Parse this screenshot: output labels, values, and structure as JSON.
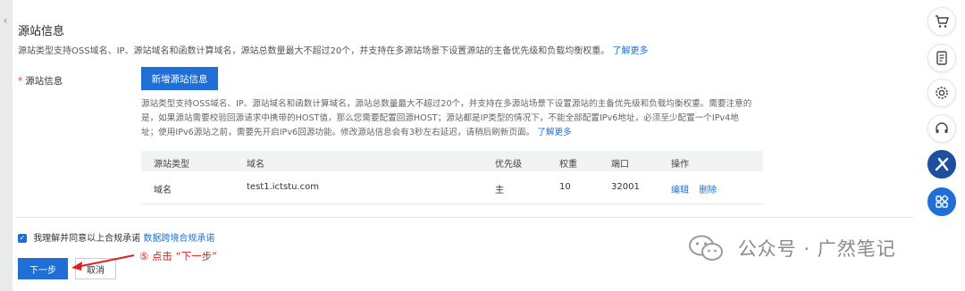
{
  "section": {
    "title": "源站信息",
    "description": "源站类型支持OSS域名、IP、源站域名和函数计算域名，源站总数量最大不超过20个，并支持在多源站场景下设置源站的主备优先级和负载均衡权重。",
    "learn_more": "了解更多"
  },
  "form": {
    "label": "源站信息",
    "required_mark": "*",
    "add_button": "新增源站信息",
    "desc_line1": "源站类型支持OSS域名、IP、源站域名和函数计算域名，源站总数量最大不超过20个，并支持在多源站场景下设置源站的主备优先级和负载均衡权重。需要注意的",
    "desc_line2": "是，如果源站需要校验回源请求中携带的HOST值，那么您需要配置回源HOST；源站都是IP类型的情况下，不能全部配置IPv6地址，必须至少配置一个IPv4地",
    "desc_line3": "址；使用IPv6源站之前，需要先开启IPv6回源功能。修改源站信息会有3秒左右延迟，请稍后刷新页面。",
    "learn_more": "了解更多"
  },
  "table": {
    "columns": [
      "源站类型",
      "域名",
      "优先级",
      "权重",
      "端口",
      "操作"
    ],
    "rows": [
      {
        "type": "域名",
        "domain": "test1.ictstu.com",
        "priority": "主",
        "weight": "10",
        "port": "32001",
        "edit": "编辑",
        "delete": "删除"
      }
    ]
  },
  "agreement": {
    "text": "我理解并同意以上合规承诺",
    "link": "数据跨境合规承诺",
    "checked": true
  },
  "buttons": {
    "next": "下一步",
    "cancel": "取消"
  },
  "annotation": "⑤ 点击 “下一步”",
  "watermark": "公众号 · 广然笔记",
  "colors": {
    "primary": "#1f6fd6",
    "annotation_red": "#e02020",
    "required_red": "#e4393c"
  },
  "sidebar_icons": [
    "cart-icon",
    "document-icon",
    "settings-icon",
    "headset-icon",
    "ai-assistant-icon",
    "apps-grid-icon"
  ]
}
